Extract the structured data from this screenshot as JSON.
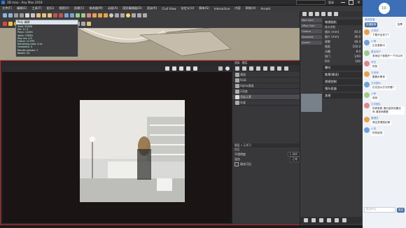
{
  "window": {
    "title": "3D max - Any Max 2018",
    "hint": "输入命令"
  },
  "menubar": {
    "items": [
      "文件(F)",
      "编辑(E)",
      "工具(T)",
      "组(G)",
      "视图(V)",
      "创建(C)",
      "修改器(M)",
      "动画(A)",
      "图形编辑器(D)",
      "渲染(R)",
      "Civil View",
      "自定义(U)",
      "脚本(S)",
      "Interactive",
      "内容",
      "帮助(H)",
      "Arnold"
    ]
  },
  "search": {
    "placeholder": "登录"
  },
  "stats": {
    "title": "Poly 编辑",
    "lines": [
      "Total: 55000",
      "Ver: 0 / 3",
      "Polys: 12450",
      "Verts: 27650",
      "Poly ms: 4.5",
      "Frame: 21 FPS",
      "Rendering time: 0.2s",
      "Geometry: 3",
      "Render passes: 1",
      "Nodes: 24"
    ]
  },
  "render_window": {
    "title": "渲染图片",
    "tab_main": "渲染",
    "tab_layers": "图层",
    "layers": [
      "通道",
      "RGB",
      "Alpha通道",
      "Z深度",
      "渲染元素",
      "灰度"
    ],
    "selected_layer": "通道",
    "settings_title": "图层 1 元学习",
    "settings_sub": "图层",
    "color_label": "不透明度",
    "color_value": "1.000",
    "blend_label": "混合",
    "blend_value": "正常",
    "check_label": "填充可见"
  },
  "right_panel": {
    "title": "物理相机",
    "buttons": [
      "Max Cam",
      "VRay Cam",
      "Corona",
      "Standard",
      "Arnold"
    ],
    "group_basic": "基本参数",
    "rows": [
      {
        "label": "镜头 (mm)",
        "value": "40.0"
      },
      {
        "label": "胶片 (mm)",
        "value": "36.0"
      },
      {
        "label": "视野",
        "value": "48.4"
      },
      {
        "label": "焦距",
        "value": "160.0"
      },
      {
        "label": "光圈",
        "value": "8.0"
      },
      {
        "label": "快门",
        "value": "1/60"
      },
      {
        "label": "ISO",
        "value": "100"
      }
    ],
    "section_exposure": "曝光",
    "section_bokeh": "散景(景深)",
    "section_perspective": "透视控制",
    "section_lens": "镜头扭曲",
    "section_misc": "其他"
  },
  "chat": {
    "time": "19:",
    "header": "我的直播",
    "broadcast_label": "好课推荐",
    "like_btn": "投票",
    "messages": [
      {
        "name": "王同学",
        "text": "下载不出来了?"
      },
      {
        "name": "小明",
        "text": "正在更新中"
      },
      {
        "name": "匿名用户",
        "text": "老师这个参数开一下可以吗"
      },
      {
        "name": "学员",
        "text": "好的"
      },
      {
        "name": "王老师",
        "text": "跟着步骤来"
      },
      {
        "name": "文字图片",
        "text": "灯光怎么打才好看?"
      },
      {
        "name": "小菲",
        "text": "收到"
      },
      {
        "name": "文字图片",
        "text": "材质参数 请问这样设置对吗 请老师看看"
      },
      {
        "name": "管理员",
        "text": "请注意课堂纪律"
      },
      {
        "name": "小张",
        "text": "好的收到"
      }
    ],
    "input_placeholder": "说点什么",
    "send_btn": "发送"
  },
  "colors": {
    "accent": "#4a6fa5",
    "render_border": "#c0282a",
    "panel_bg": "#3a3a3d",
    "chat_bg": "#eef2f7"
  }
}
